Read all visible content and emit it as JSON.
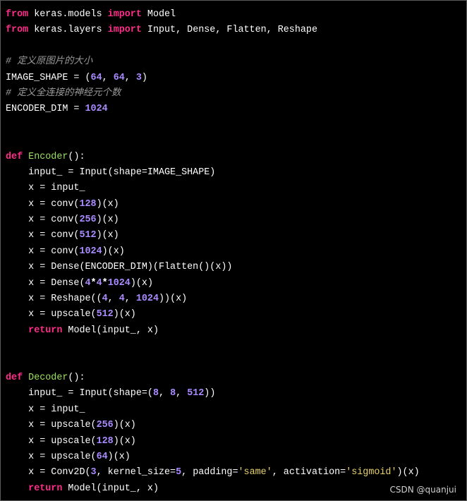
{
  "code_lines": [
    [
      {
        "t": "kw",
        "v": "from"
      },
      {
        "t": "plain",
        "v": " keras.models "
      },
      {
        "t": "kw",
        "v": "import"
      },
      {
        "t": "plain",
        "v": " Model"
      }
    ],
    [
      {
        "t": "kw",
        "v": "from"
      },
      {
        "t": "plain",
        "v": " keras.layers "
      },
      {
        "t": "kw",
        "v": "import"
      },
      {
        "t": "plain",
        "v": " Input, Dense, Flatten, Reshape"
      }
    ],
    [],
    [
      {
        "t": "cmt",
        "v": "# 定义原图片的大小"
      }
    ],
    [
      {
        "t": "plain",
        "v": "IMAGE_SHAPE = ("
      },
      {
        "t": "num",
        "v": "64"
      },
      {
        "t": "plain",
        "v": ", "
      },
      {
        "t": "num",
        "v": "64"
      },
      {
        "t": "plain",
        "v": ", "
      },
      {
        "t": "num",
        "v": "3"
      },
      {
        "t": "plain",
        "v": ")"
      }
    ],
    [
      {
        "t": "cmt",
        "v": "# 定义全连接的神经元个数"
      }
    ],
    [
      {
        "t": "plain",
        "v": "ENCODER_DIM = "
      },
      {
        "t": "num",
        "v": "1024"
      }
    ],
    [],
    [],
    [
      {
        "t": "kw",
        "v": "def"
      },
      {
        "t": "plain",
        "v": " "
      },
      {
        "t": "fn",
        "v": "Encoder"
      },
      {
        "t": "plain",
        "v": "():"
      }
    ],
    [
      {
        "t": "plain",
        "v": "    input_ = Input(shape=IMAGE_SHAPE)"
      }
    ],
    [
      {
        "t": "plain",
        "v": "    x = input_"
      }
    ],
    [
      {
        "t": "plain",
        "v": "    x = conv("
      },
      {
        "t": "num",
        "v": "128"
      },
      {
        "t": "plain",
        "v": ")(x)"
      }
    ],
    [
      {
        "t": "plain",
        "v": "    x = conv("
      },
      {
        "t": "num",
        "v": "256"
      },
      {
        "t": "plain",
        "v": ")(x)"
      }
    ],
    [
      {
        "t": "plain",
        "v": "    x = conv("
      },
      {
        "t": "num",
        "v": "512"
      },
      {
        "t": "plain",
        "v": ")(x)"
      }
    ],
    [
      {
        "t": "plain",
        "v": "    x = conv("
      },
      {
        "t": "num",
        "v": "1024"
      },
      {
        "t": "plain",
        "v": ")(x)"
      }
    ],
    [
      {
        "t": "plain",
        "v": "    x = Dense(ENCODER_DIM)(Flatten()(x))"
      }
    ],
    [
      {
        "t": "plain",
        "v": "    x = Dense("
      },
      {
        "t": "num",
        "v": "4"
      },
      {
        "t": "op",
        "v": "*"
      },
      {
        "t": "num",
        "v": "4"
      },
      {
        "t": "op",
        "v": "*"
      },
      {
        "t": "num",
        "v": "1024"
      },
      {
        "t": "plain",
        "v": ")(x)"
      }
    ],
    [
      {
        "t": "plain",
        "v": "    x = Reshape(("
      },
      {
        "t": "num",
        "v": "4"
      },
      {
        "t": "plain",
        "v": ", "
      },
      {
        "t": "num",
        "v": "4"
      },
      {
        "t": "plain",
        "v": ", "
      },
      {
        "t": "num",
        "v": "1024"
      },
      {
        "t": "plain",
        "v": "))(x)"
      }
    ],
    [
      {
        "t": "plain",
        "v": "    x = upscale("
      },
      {
        "t": "num",
        "v": "512"
      },
      {
        "t": "plain",
        "v": ")(x)"
      }
    ],
    [
      {
        "t": "plain",
        "v": "    "
      },
      {
        "t": "kw",
        "v": "return"
      },
      {
        "t": "plain",
        "v": " Model(input_, x)"
      }
    ],
    [],
    [],
    [
      {
        "t": "kw",
        "v": "def"
      },
      {
        "t": "plain",
        "v": " "
      },
      {
        "t": "fn",
        "v": "Decoder"
      },
      {
        "t": "plain",
        "v": "():"
      }
    ],
    [
      {
        "t": "plain",
        "v": "    input_ = Input(shape=("
      },
      {
        "t": "num",
        "v": "8"
      },
      {
        "t": "plain",
        "v": ", "
      },
      {
        "t": "num",
        "v": "8"
      },
      {
        "t": "plain",
        "v": ", "
      },
      {
        "t": "num",
        "v": "512"
      },
      {
        "t": "plain",
        "v": "))"
      }
    ],
    [
      {
        "t": "plain",
        "v": "    x = input_"
      }
    ],
    [
      {
        "t": "plain",
        "v": "    x = upscale("
      },
      {
        "t": "num",
        "v": "256"
      },
      {
        "t": "plain",
        "v": ")(x)"
      }
    ],
    [
      {
        "t": "plain",
        "v": "    x = upscale("
      },
      {
        "t": "num",
        "v": "128"
      },
      {
        "t": "plain",
        "v": ")(x)"
      }
    ],
    [
      {
        "t": "plain",
        "v": "    x = upscale("
      },
      {
        "t": "num",
        "v": "64"
      },
      {
        "t": "plain",
        "v": ")(x)"
      }
    ],
    [
      {
        "t": "plain",
        "v": "    x = Conv2D("
      },
      {
        "t": "num",
        "v": "3"
      },
      {
        "t": "plain",
        "v": ", kernel_size="
      },
      {
        "t": "num",
        "v": "5"
      },
      {
        "t": "plain",
        "v": ", padding="
      },
      {
        "t": "str",
        "v": "'same'"
      },
      {
        "t": "plain",
        "v": ", activation="
      },
      {
        "t": "str",
        "v": "'sigmoid'"
      },
      {
        "t": "plain",
        "v": ")(x)"
      }
    ],
    [
      {
        "t": "plain",
        "v": "    "
      },
      {
        "t": "kw",
        "v": "return"
      },
      {
        "t": "plain",
        "v": " Model(input_, x)"
      }
    ]
  ],
  "watermark": "CSDN @quanjui",
  "colors": {
    "background": "#000000",
    "plain": "#ffffff",
    "keyword": "#ff2d8a",
    "number": "#a98bff",
    "string": "#e7d26a",
    "comment": "#9a9a9a",
    "function_name": "#9be15d"
  }
}
